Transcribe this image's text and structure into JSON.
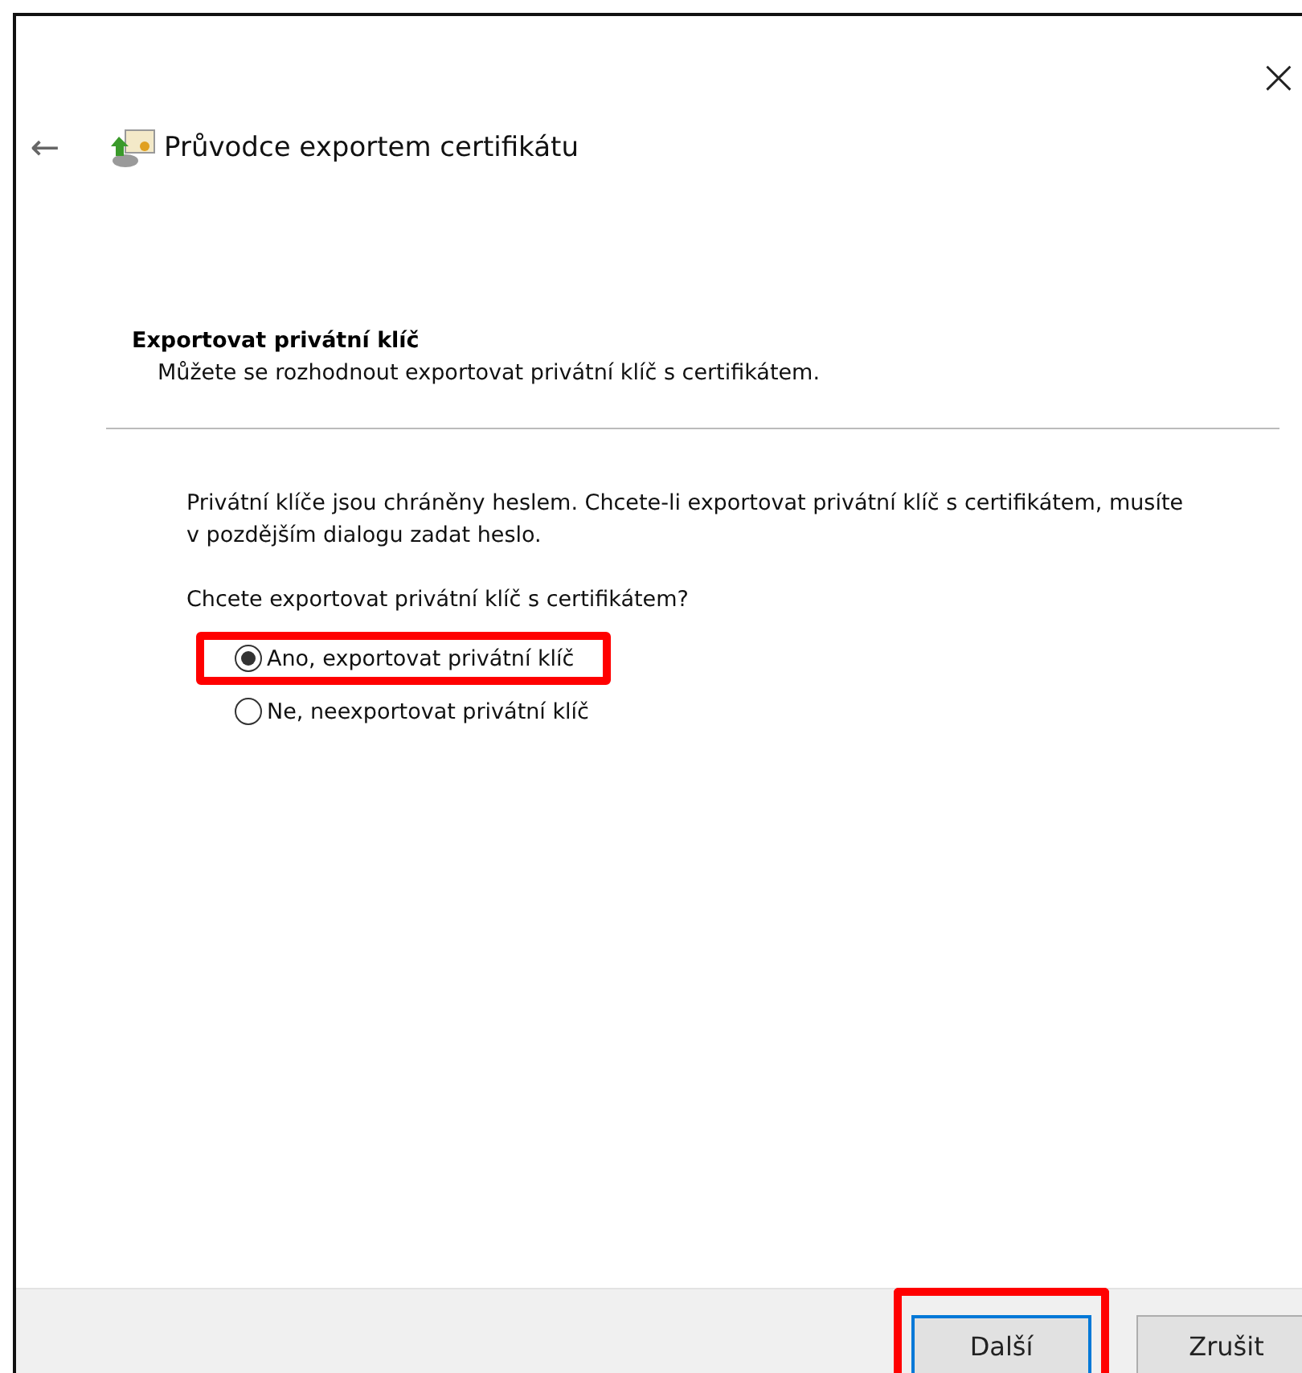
{
  "window": {
    "close": "×"
  },
  "header": {
    "back": "←",
    "title": "Průvodce exportem certifikátu"
  },
  "section": {
    "title": "Exportovat privátní klíč",
    "subtitle": "Můžete se rozhodnout exportovat privátní klíč s certifikátem."
  },
  "body": {
    "paragraph": "Privátní klíče jsou chráněny heslem. Chcete-li exportovat privátní klíč s certifikátem, musíte v pozdějším dialogu zadat heslo.",
    "question": "Chcete exportovat privátní klíč s certifikátem?"
  },
  "options": [
    {
      "label": "Ano, exportovat privátní klíč",
      "selected": true,
      "highlighted": true
    },
    {
      "label": "Ne, neexportovat privátní klíč",
      "selected": false,
      "highlighted": false
    }
  ],
  "buttons": [
    {
      "label": "Další",
      "default": true,
      "highlighted": true
    },
    {
      "label": "Zrušit",
      "default": false,
      "highlighted": false
    }
  ]
}
